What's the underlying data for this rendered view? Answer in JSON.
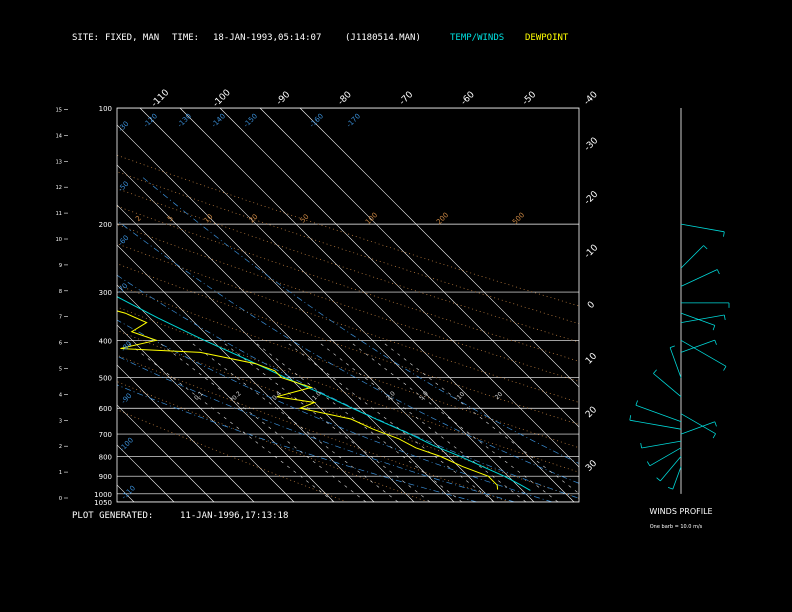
{
  "header": {
    "site_label": "SITE:",
    "site_value": "FIXED, MAN",
    "time_label": "TIME:",
    "time_value": "18-JAN-1993,05:14:07",
    "file_id": "(J1180514.MAN)",
    "legend_temp": "TEMP/WINDS",
    "legend_dew": "DEWPOINT"
  },
  "footer": {
    "generated_label": "PLOT GENERATED:",
    "generated_value": "11-JAN-1996,17:13:18"
  },
  "colors": {
    "background": "#000000",
    "temperature": "#00d8d8",
    "dewpoint": "#ffff00",
    "isobar": "#ffffff",
    "isotherm": "#ffffff",
    "dry_adiabat": "#cc8844",
    "moist_adiabat": "#3a8fd8",
    "mixing_ratio": "#dddddd",
    "wind": "#00d8d8"
  },
  "winds": {
    "title": "WINDS PROFILE",
    "note": "One barb = 10.0 m/s"
  },
  "chart_data": {
    "type": "line",
    "title": "",
    "xlabel": "",
    "ylabel": "",
    "ylim": [
      1050,
      100
    ],
    "pressure_labels": [
      "100",
      "200",
      "300",
      "400",
      "500",
      "600",
      "700",
      "800",
      "900",
      "1000",
      "1050"
    ],
    "height_labels": [
      "0",
      "1",
      "2",
      "3",
      "4",
      "5",
      "6",
      "7",
      "8",
      "9",
      "10",
      "11",
      "12",
      "13",
      "14",
      "15"
    ],
    "isotherm_top_labels": [
      "-110",
      "-100",
      "-90",
      "-80",
      "-70",
      "-60",
      "-50",
      "-40"
    ],
    "isotherm_right_labels": [
      "-30",
      "-20",
      "-10",
      "0",
      "10",
      "20",
      "30"
    ],
    "dry_adiabat_labels": [
      "-30",
      "-50",
      "-60",
      "-70",
      "-80",
      "-90",
      "-100",
      "-110",
      "-120",
      "-130",
      "-140",
      "-150",
      "-160",
      "-170"
    ],
    "orange_labels": [
      "2",
      "5",
      "10",
      "20",
      "50",
      "100",
      "200",
      "500"
    ],
    "mixing_ratio_labels": [
      "0.1",
      "0.2",
      "0.4",
      "1.0",
      "2.0",
      "5.0",
      "10",
      "20"
    ],
    "series": [
      {
        "key": "temperature",
        "points": [
          [
            100,
            -70
          ],
          [
            115,
            -68
          ],
          [
            135,
            -63
          ],
          [
            160,
            -60
          ],
          [
            190,
            -58
          ],
          [
            220,
            -55
          ],
          [
            260,
            -49
          ],
          [
            300,
            -44
          ],
          [
            350,
            -38
          ],
          [
            400,
            -32
          ],
          [
            450,
            -26
          ],
          [
            500,
            -21
          ],
          [
            550,
            -16
          ],
          [
            600,
            -12
          ],
          [
            650,
            -8
          ],
          [
            700,
            -4
          ],
          [
            750,
            -1
          ],
          [
            800,
            3
          ],
          [
            850,
            6
          ],
          [
            900,
            9
          ],
          [
            950,
            11
          ],
          [
            980,
            12
          ]
        ]
      },
      {
        "key": "dewpoint",
        "points": [
          [
            100,
            -78
          ],
          [
            120,
            -80
          ],
          [
            150,
            -79
          ],
          [
            190,
            -72
          ],
          [
            220,
            -66
          ],
          [
            240,
            -65
          ],
          [
            270,
            -76
          ],
          [
            285,
            -72
          ],
          [
            300,
            -60
          ],
          [
            320,
            -52
          ],
          [
            340,
            -45
          ],
          [
            360,
            -42
          ],
          [
            380,
            -48
          ],
          [
            400,
            -44
          ],
          [
            420,
            -55
          ],
          [
            430,
            -36
          ],
          [
            460,
            -25
          ],
          [
            480,
            -22
          ],
          [
            500,
            -22
          ],
          [
            530,
            -17
          ],
          [
            560,
            -28
          ],
          [
            580,
            -20
          ],
          [
            600,
            -25
          ],
          [
            640,
            -15
          ],
          [
            680,
            -12
          ],
          [
            720,
            -8
          ],
          [
            760,
            -6
          ],
          [
            800,
            -2
          ],
          [
            850,
            1
          ],
          [
            900,
            5
          ],
          [
            950,
            5
          ],
          [
            975,
            4
          ]
        ]
      }
    ],
    "wind_profile": [
      {
        "pressure": 200,
        "direction_deg": 280,
        "speed_ms": 40
      },
      {
        "pressure": 260,
        "direction_deg": 225,
        "speed_ms": 25
      },
      {
        "pressure": 290,
        "direction_deg": 245,
        "speed_ms": 35
      },
      {
        "pressure": 320,
        "direction_deg": 270,
        "speed_ms": 45
      },
      {
        "pressure": 340,
        "direction_deg": 290,
        "speed_ms": 30
      },
      {
        "pressure": 360,
        "direction_deg": 260,
        "speed_ms": 40
      },
      {
        "pressure": 400,
        "direction_deg": 300,
        "speed_ms": 50
      },
      {
        "pressure": 430,
        "direction_deg": 250,
        "speed_ms": 30
      },
      {
        "pressure": 500,
        "direction_deg": 160,
        "speed_ms": 25
      },
      {
        "pressure": 560,
        "direction_deg": 130,
        "speed_ms": 30
      },
      {
        "pressure": 620,
        "direction_deg": 300,
        "speed_ms": 35
      },
      {
        "pressure": 650,
        "direction_deg": 110,
        "speed_ms": 45
      },
      {
        "pressure": 680,
        "direction_deg": 100,
        "speed_ms": 50
      },
      {
        "pressure": 700,
        "direction_deg": 250,
        "speed_ms": 30
      },
      {
        "pressure": 730,
        "direction_deg": 80,
        "speed_ms": 35
      },
      {
        "pressure": 760,
        "direction_deg": 60,
        "speed_ms": 30
      },
      {
        "pressure": 800,
        "direction_deg": 40,
        "speed_ms": 25
      },
      {
        "pressure": 850,
        "direction_deg": 20,
        "speed_ms": 15
      }
    ]
  }
}
